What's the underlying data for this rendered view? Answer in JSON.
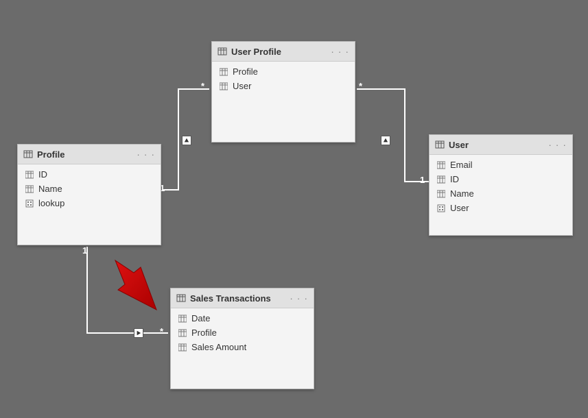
{
  "tables": {
    "profile": {
      "title": "Profile",
      "fields": [
        {
          "name": "ID",
          "type": "column"
        },
        {
          "name": "Name",
          "type": "column"
        },
        {
          "name": "lookup",
          "type": "measure"
        }
      ]
    },
    "userProfile": {
      "title": "User Profile",
      "fields": [
        {
          "name": "Profile",
          "type": "column"
        },
        {
          "name": "User",
          "type": "column"
        }
      ]
    },
    "user": {
      "title": "User",
      "fields": [
        {
          "name": "Email",
          "type": "column"
        },
        {
          "name": "ID",
          "type": "column"
        },
        {
          "name": "Name",
          "type": "column"
        },
        {
          "name": "User",
          "type": "measure"
        }
      ]
    },
    "salesTransactions": {
      "title": "Sales Transactions",
      "fields": [
        {
          "name": "Date",
          "type": "column"
        },
        {
          "name": "Profile",
          "type": "column"
        },
        {
          "name": "Sales Amount",
          "type": "column"
        }
      ]
    }
  },
  "relationships": {
    "profile_userProfile": {
      "from": "1",
      "to": "*"
    },
    "user_userProfile": {
      "from": "1",
      "to": "*"
    },
    "profile_salesTransactions": {
      "from": "1",
      "to": "*"
    }
  },
  "annotation": {
    "arrow": "red pointer arrow indicating Sales Transactions table"
  }
}
